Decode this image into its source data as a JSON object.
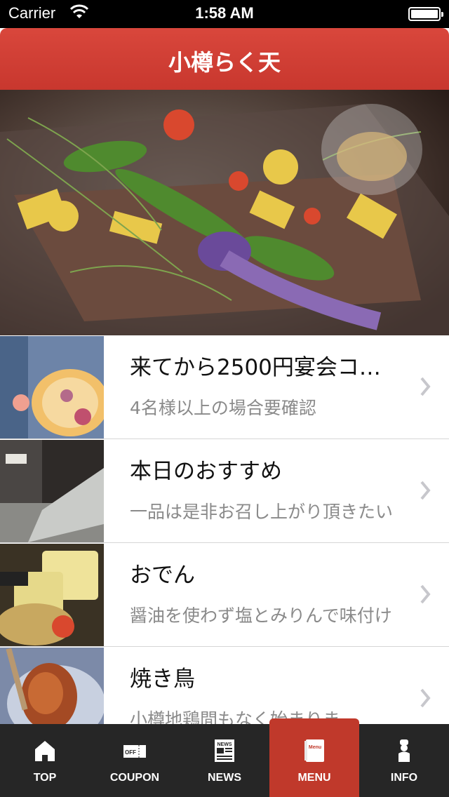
{
  "status_bar": {
    "carrier": "Carrier",
    "time": "1:58 AM"
  },
  "nav": {
    "title": "小樽らく天",
    "color": "#d9473c"
  },
  "list": [
    {
      "title": "来てから2500円宴会コ…",
      "subtitle": "4名様以上の場合要確認"
    },
    {
      "title": "本日のおすすめ",
      "subtitle": "一品は是非お召し上がり頂きたい"
    },
    {
      "title": "おでん",
      "subtitle": "醤油を使わず塩とみりんで味付け"
    },
    {
      "title": "焼き鳥",
      "subtitle": "小樽地鶏間もなく始まりま"
    }
  ],
  "tabbar": {
    "items": [
      {
        "label": "TOP",
        "icon": "home-icon"
      },
      {
        "label": "COUPON",
        "icon": "coupon-icon",
        "icon_text": "OFF"
      },
      {
        "label": "NEWS",
        "icon": "news-icon",
        "icon_text": "NEWS"
      },
      {
        "label": "MENU",
        "icon": "menu-book-icon",
        "icon_text": "Menu",
        "active": true
      },
      {
        "label": "INFO",
        "icon": "chef-icon"
      }
    ],
    "active_color": "#c0392b"
  }
}
